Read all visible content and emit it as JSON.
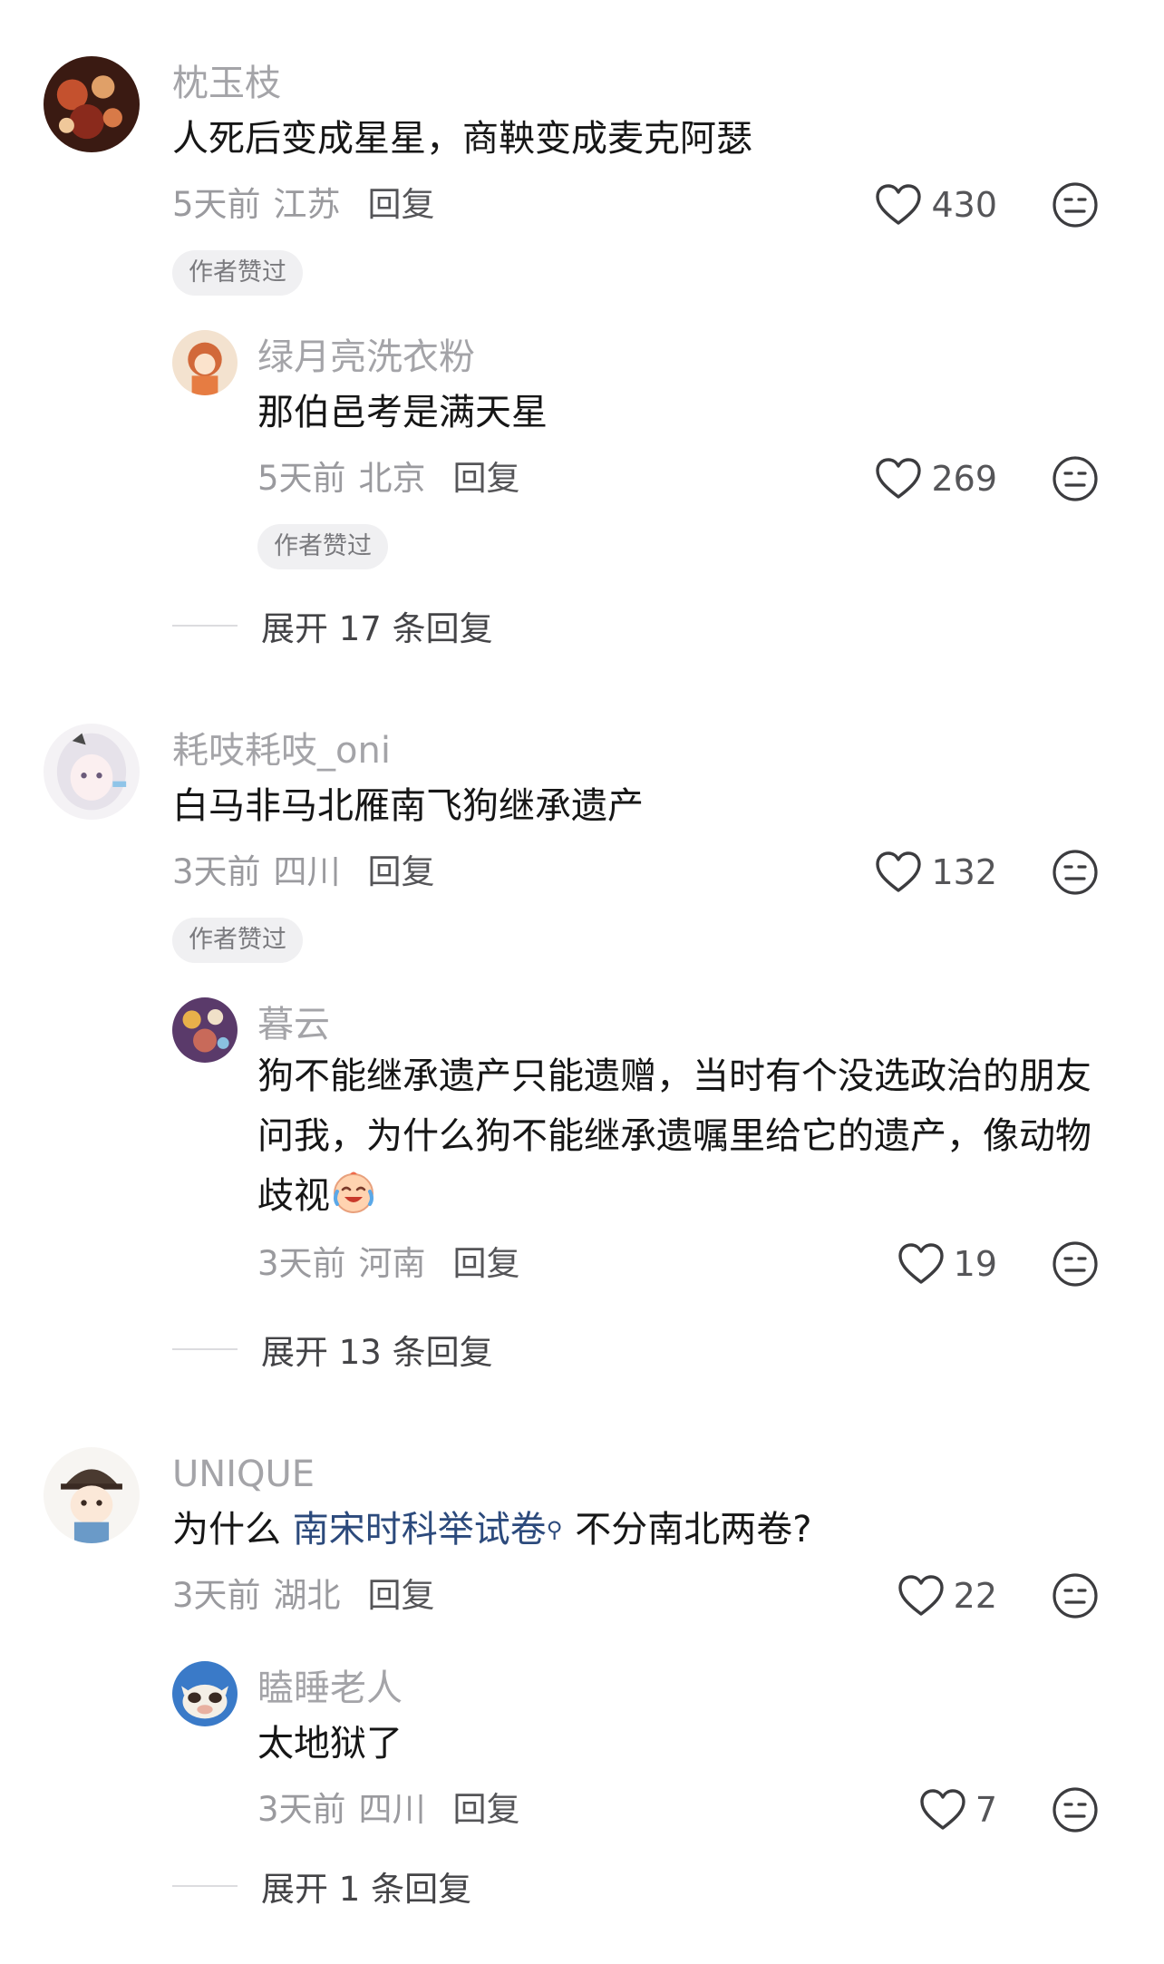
{
  "threads": [
    {
      "comment": {
        "username": "枕玉枝",
        "text": "人死后变成星星，商鞅变成麦克阿瑟",
        "time": "5天前",
        "location": "江苏",
        "reply_label": "回复",
        "likes": "430",
        "badge": "作者赞过"
      },
      "reply": {
        "username": "绿月亮洗衣粉",
        "text": "那伯邑考是满天星",
        "time": "5天前",
        "location": "北京",
        "reply_label": "回复",
        "likes": "269",
        "badge": "作者赞过"
      },
      "expand": "展开 17 条回复"
    },
    {
      "comment": {
        "username": "耗吱耗吱_oni",
        "text": "白马非马北雁南飞狗继承遗产",
        "time": "3天前",
        "location": "四川",
        "reply_label": "回复",
        "likes": "132",
        "badge": "作者赞过"
      },
      "reply": {
        "username": "暮云",
        "text": "狗不能继承遗产只能遗赠，当时有个没选政治的朋友问我，为什么狗不能继承遗嘱里给它的遗产，像动物歧视",
        "emoji": "laughing-crying-emoji",
        "time": "3天前",
        "location": "河南",
        "reply_label": "回复",
        "likes": "19"
      },
      "expand": "展开 13 条回复"
    },
    {
      "comment": {
        "username": "UNIQUE",
        "text_before": "为什么 ",
        "link_text": "南宋时科举试卷",
        "text_after": "不分南北两卷?",
        "time": "3天前",
        "location": "湖北",
        "reply_label": "回复",
        "likes": "22"
      },
      "reply": {
        "username": "瞌睡老人",
        "text": "太地狱了",
        "time": "3天前",
        "location": "四川",
        "reply_label": "回复",
        "likes": "7"
      },
      "expand": "展开 1 条回复"
    }
  ],
  "icons": {
    "like": "heart-outline-icon",
    "dislike": "meh-face-icon",
    "search_mark": "search-icon"
  },
  "colors": {
    "username": "#a4a4a8",
    "text": "#161616",
    "link": "#2c4a7c",
    "badge_bg": "#f0f0f2"
  }
}
